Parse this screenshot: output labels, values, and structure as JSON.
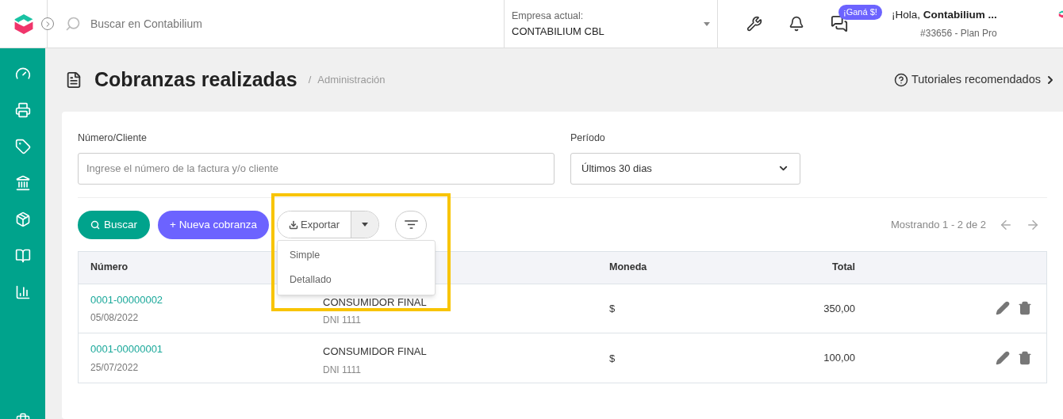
{
  "header": {
    "search_placeholder": "Buscar en Contabilium",
    "company": {
      "label": "Empresa actual:",
      "value": "CONTABILIUM CBL"
    },
    "promo_badge": "¡Ganá $!",
    "user": {
      "greeting": "¡Hola, **Contabilium ...**",
      "account": "#33656 - Plan Pro"
    }
  },
  "page": {
    "title": "Cobranzas realizadas",
    "breadcrumb_separator": "/",
    "breadcrumb": "Administración",
    "tutorials_link": "Tutoriales recomendados"
  },
  "filters": [
    {
      "kind": "text",
      "label": "Número/Cliente",
      "placeholder": "Ingrese el número de la factura y/o cliente"
    },
    {
      "kind": "select",
      "label": "Período",
      "value": "Últimos 30 dias"
    }
  ],
  "actions": {
    "search": "Buscar",
    "new": "+ Nueva cobranza",
    "export": "Exportar"
  },
  "export_menu": {
    "expanded": true,
    "items": [
      "Simple",
      "Detallado"
    ]
  },
  "pagination": "Mostrando 1 - 2 de 2",
  "table": {
    "columns": [
      {
        "label": "Número"
      },
      {},
      {
        "label": "Moneda"
      },
      {
        "label": "Total"
      }
    ],
    "rows": [
      {
        "number": "0001-00000002",
        "date": "05/08/2022",
        "client": "CONSUMIDOR FINAL",
        "doc": "DNI 1111",
        "currency": "$",
        "total": "350,00"
      },
      {
        "number": "0001-00000001",
        "date": "25/07/2022",
        "client": "CONSUMIDOR FINAL",
        "doc": "DNI 1111",
        "currency": "$",
        "total": "100,00"
      }
    ]
  }
}
